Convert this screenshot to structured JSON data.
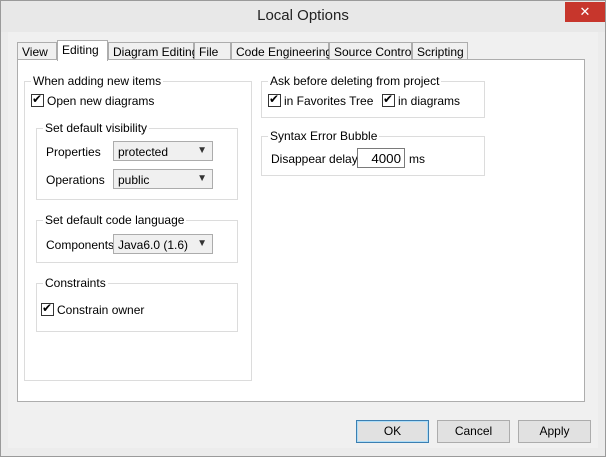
{
  "window": {
    "title": "Local Options",
    "close_glyph": "✕"
  },
  "tabs": [
    {
      "label": "View"
    },
    {
      "label": "Editing",
      "active": true
    },
    {
      "label": "Diagram Editing"
    },
    {
      "label": "File"
    },
    {
      "label": "Code Engineering"
    },
    {
      "label": "Source Control"
    },
    {
      "label": "Scripting"
    }
  ],
  "new_items": {
    "legend": "When adding new items",
    "open_new_diagrams": {
      "label": "Open new diagrams",
      "checked": true
    },
    "visibility": {
      "legend": "Set default visibility",
      "properties_label": "Properties",
      "properties_value": "protected",
      "operations_label": "Operations",
      "operations_value": "public"
    },
    "code_language": {
      "legend": "Set default code language",
      "components_label": "Components",
      "components_value": "Java6.0 (1.6)"
    },
    "constraints": {
      "legend": "Constraints",
      "constrain_owner": {
        "label": "Constrain owner",
        "checked": true
      }
    }
  },
  "ask_delete": {
    "legend": "Ask before deleting from project",
    "favorites": {
      "label": "in Favorites Tree",
      "checked": true
    },
    "diagrams": {
      "label": "in diagrams",
      "checked": true
    }
  },
  "syntax_error": {
    "legend": "Syntax Error Bubble",
    "delay_label": "Disappear delay:",
    "delay_value": "4000",
    "unit": "ms"
  },
  "buttons": {
    "ok": "OK",
    "cancel": "Cancel",
    "apply": "Apply"
  },
  "icons": {
    "check": "✔",
    "dropdown": "▼"
  }
}
